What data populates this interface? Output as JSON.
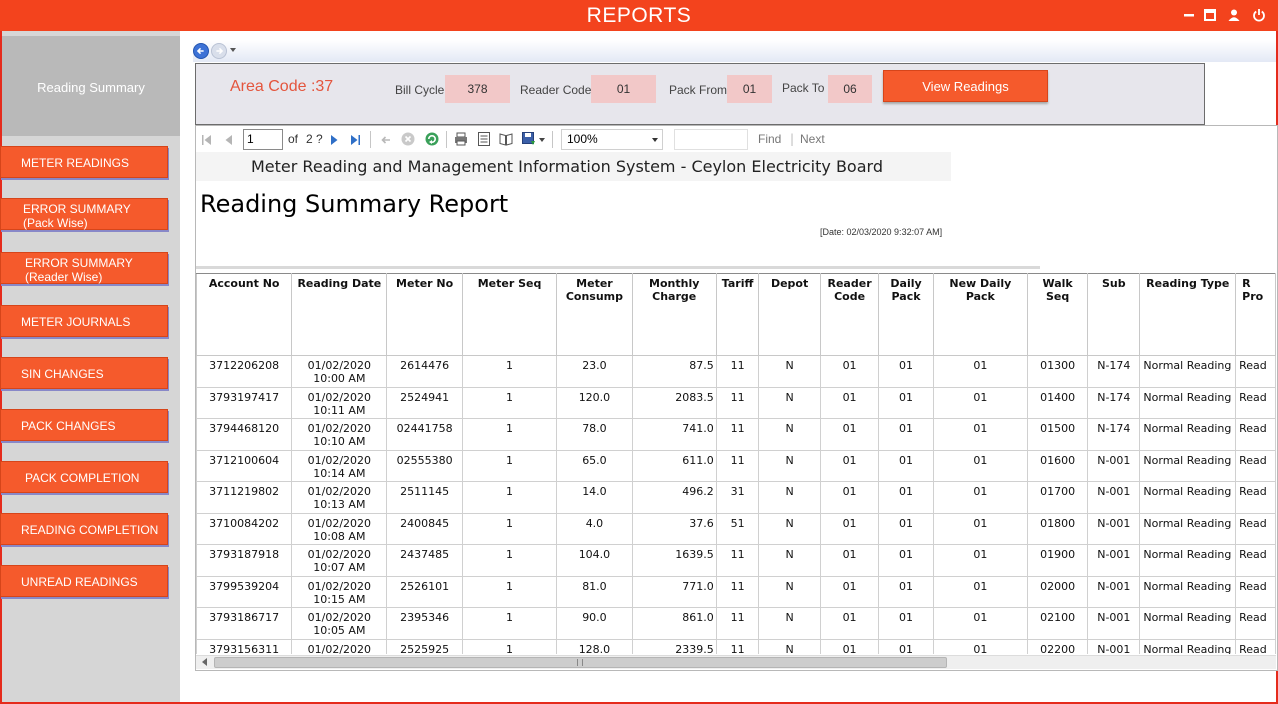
{
  "app": {
    "title": "REPORTS",
    "colors": {
      "brand": "#f3431d",
      "button": "#f55a2c",
      "sidebar": "#d6d6d6",
      "param_box": "#f2c8c8"
    },
    "window_controls": [
      "minimize-icon",
      "maximize-icon",
      "user-icon",
      "power-icon"
    ]
  },
  "sidebar": {
    "header": "Reading Summary",
    "items": [
      {
        "label": "METER READINGS"
      },
      {
        "label": "ERROR SUMMARY\n(Pack Wise)"
      },
      {
        "label": "ERROR SUMMARY\n(Reader Wise)"
      },
      {
        "label": "METER JOURNALS"
      },
      {
        "label": "SIN CHANGES"
      },
      {
        "label": "PACK CHANGES"
      },
      {
        "label": "PACK COMPLETION"
      },
      {
        "label": "READING COMPLETION"
      },
      {
        "label": "UNREAD READINGS"
      }
    ]
  },
  "params": {
    "area_code": "Area Code :37",
    "bill_cycle_label": "Bill Cycle",
    "bill_cycle": "378",
    "reader_code_label": "Reader Code",
    "reader_code": "01",
    "pack_from_label": "Pack From",
    "pack_from": "01",
    "pack_to_label": "Pack To",
    "pack_to": "06",
    "view_button": "View Readings"
  },
  "viewer": {
    "page": "1",
    "of_label": "of",
    "total_pages": "2 ?",
    "zoom": "100%",
    "find": "Find",
    "next": "Next"
  },
  "report": {
    "system": "Meter Reading and Management Information System - Ceylon Electricity Board",
    "title": "Reading Summary Report",
    "date": "[Date: 02/03/2020 9:32:07 AM]",
    "columns": [
      "Account No",
      "Reading Date",
      "Meter No",
      "Meter Seq",
      "Meter\nConsump",
      "Monthly\nCharge",
      "Tariff",
      "Depot",
      "Reader\nCode",
      "Daily\nPack",
      "New Daily\nPack",
      "Walk\nSeq",
      "Sub",
      "Reading Type",
      "R\nPro"
    ],
    "rows": [
      [
        "3712206208",
        "01/02/2020\n10:00 AM",
        "2614476",
        "1",
        "23.0",
        "87.5",
        "11",
        "N",
        "01",
        "01",
        "01",
        "01300",
        "N-174",
        "Normal Reading",
        "Read"
      ],
      [
        "3793197417",
        "01/02/2020\n10:11 AM",
        "2524941",
        "1",
        "120.0",
        "2083.5",
        "11",
        "N",
        "01",
        "01",
        "01",
        "01400",
        "N-174",
        "Normal Reading",
        "Read"
      ],
      [
        "3794468120",
        "01/02/2020\n10:10 AM",
        "02441758",
        "1",
        "78.0",
        "741.0",
        "11",
        "N",
        "01",
        "01",
        "01",
        "01500",
        "N-174",
        "Normal Reading",
        "Read"
      ],
      [
        "3712100604",
        "01/02/2020\n10:14 AM",
        "02555380",
        "1",
        "65.0",
        "611.0",
        "11",
        "N",
        "01",
        "01",
        "01",
        "01600",
        "N-001",
        "Normal Reading",
        "Read"
      ],
      [
        "3711219802",
        "01/02/2020\n10:13 AM",
        "2511145",
        "1",
        "14.0",
        "496.2",
        "31",
        "N",
        "01",
        "01",
        "01",
        "01700",
        "N-001",
        "Normal Reading",
        "Read"
      ],
      [
        "3710084202",
        "01/02/2020\n10:08 AM",
        "2400845",
        "1",
        "4.0",
        "37.6",
        "51",
        "N",
        "01",
        "01",
        "01",
        "01800",
        "N-001",
        "Normal Reading",
        "Read"
      ],
      [
        "3793187918",
        "01/02/2020\n10:07 AM",
        "2437485",
        "1",
        "104.0",
        "1639.5",
        "11",
        "N",
        "01",
        "01",
        "01",
        "01900",
        "N-001",
        "Normal Reading",
        "Read"
      ],
      [
        "3799539204",
        "01/02/2020\n10:15 AM",
        "2526101",
        "1",
        "81.0",
        "771.0",
        "11",
        "N",
        "01",
        "01",
        "01",
        "02000",
        "N-001",
        "Normal Reading",
        "Read"
      ],
      [
        "3793186717",
        "01/02/2020\n10:05 AM",
        "2395346",
        "1",
        "90.0",
        "861.0",
        "11",
        "N",
        "01",
        "01",
        "01",
        "02100",
        "N-001",
        "Normal Reading",
        "Read"
      ],
      [
        "3793156311",
        "01/02/2020",
        "2525925",
        "1",
        "128.0",
        "2339.5",
        "11",
        "N",
        "01",
        "01",
        "01",
        "02200",
        "N-001",
        "Normal Reading",
        "Read"
      ]
    ]
  }
}
